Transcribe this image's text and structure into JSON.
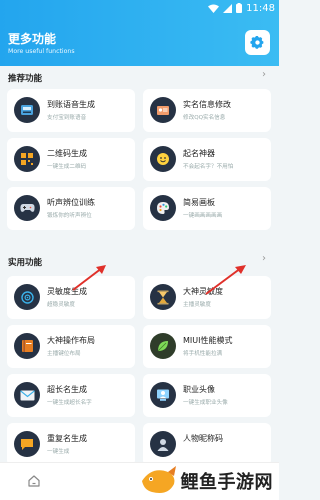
{
  "status_bar": {
    "time": "11:48"
  },
  "header": {
    "title": "更多功能",
    "subtitle": "More useful functions",
    "settings_icon": "gear-icon"
  },
  "sections": [
    {
      "title": "推荐功能",
      "chevron": "›",
      "items": [
        {
          "title": "到账语音生成",
          "desc": "支付宝到账语音",
          "icon": "cash-register-icon"
        },
        {
          "title": "实名信息修改",
          "desc": "修改QQ实名信息",
          "icon": "id-card-icon"
        },
        {
          "title": "二维码生成",
          "desc": "一键生成二维码",
          "icon": "qr-code-icon"
        },
        {
          "title": "起名神器",
          "desc": "不会起名字？不用怕",
          "icon": "smiley-icon"
        },
        {
          "title": "听声辨位训练",
          "desc": "锻炼你的听声辨位",
          "icon": "gamepad-icon"
        },
        {
          "title": "简易画板",
          "desc": "一键画画画画画",
          "icon": "paint-palette-icon"
        }
      ]
    },
    {
      "title": "实用功能",
      "chevron": "›",
      "items": [
        {
          "title": "灵敏度生成",
          "desc": "超稳灵敏度",
          "icon": "crosshair-icon"
        },
        {
          "title": "大神灵敏度",
          "desc": "主播灵敏度",
          "icon": "hourglass-icon"
        },
        {
          "title": "大神操作布局",
          "desc": "主播键位布局",
          "icon": "book-icon"
        },
        {
          "title": "MIUI性能模式",
          "desc": "将手机性能拉满",
          "icon": "leaf-icon"
        },
        {
          "title": "超长名生成",
          "desc": "一键生成超长名字",
          "icon": "envelope-icon"
        },
        {
          "title": "职业头像",
          "desc": "一键生成职业头像",
          "icon": "avatar-frame-icon"
        },
        {
          "title": "重复名生成",
          "desc": "一键生成",
          "icon": "chat-icon"
        },
        {
          "title": "人物昵称码",
          "desc": "",
          "icon": "person-icon"
        }
      ]
    }
  ],
  "bottom_nav": {
    "home_icon": "home-icon"
  },
  "watermark": {
    "text": "鲤鱼手游网",
    "icon": "fish-logo-icon"
  },
  "colors": {
    "header": "#23a5ee",
    "icon_bg": "#263244",
    "arrow": "#e0302a"
  }
}
